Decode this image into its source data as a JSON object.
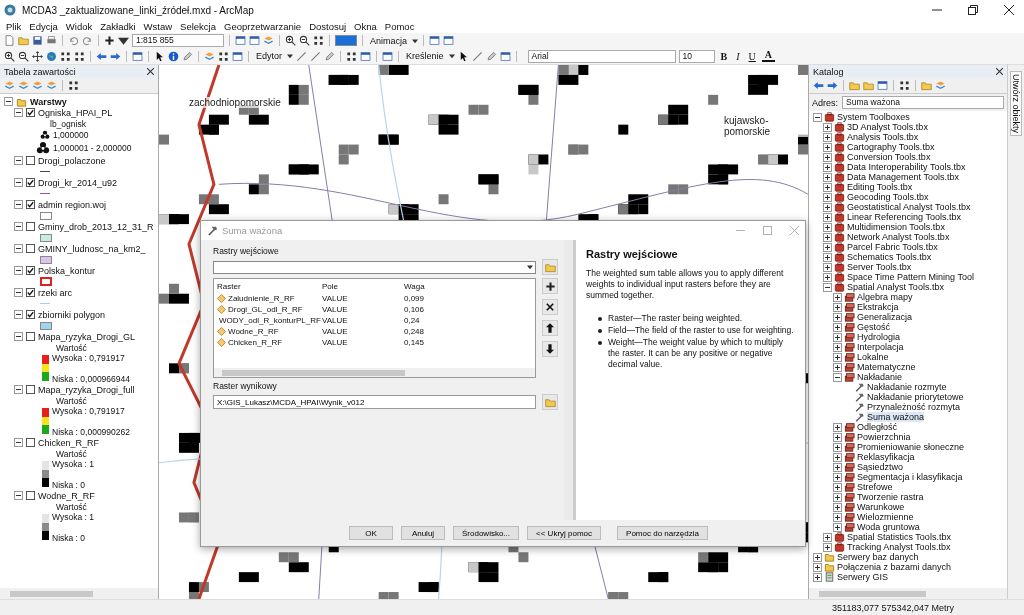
{
  "window": {
    "title": "MCDA3 _zaktualizowane_linki_źródeł.mxd - ArcMap"
  },
  "menu": [
    "Plik",
    "Edycja",
    "Widok",
    "Zakładki",
    "Wstaw",
    "Selekcja",
    "Geoprzetwarzanie",
    "Dostosuj",
    "Okna",
    "Pomoc"
  ],
  "toolbar": {
    "scale": "1:815 855",
    "editor": "Edytor",
    "animation": "Animacja",
    "drawing": "Kreślenie",
    "font": "Arial",
    "font_size": "10",
    "bold": "B",
    "italic": "I",
    "underline": "U",
    "font_color": "A"
  },
  "toc": {
    "title": "Tabela zawartości",
    "root": "Warstwy",
    "layers": [
      {
        "name": "Ogniska_HPAI_PL",
        "checked": true,
        "expanded": true,
        "legend": [
          {
            "kind": "heading",
            "label": "lb_ognisk"
          },
          {
            "kind": "symbol",
            "label": "1,000000"
          },
          {
            "kind": "symbol-large",
            "label": "1,000001 - 2,000000"
          }
        ]
      },
      {
        "name": "Drogi_polaczone",
        "checked": false,
        "expanded": true,
        "legend": [
          {
            "kind": "line",
            "color": "#5a3a6a"
          }
        ]
      },
      {
        "name": "Drogi_kr_2014_u92",
        "checked": true,
        "expanded": true,
        "legend": [
          {
            "kind": "line",
            "color": "#8a5a9a"
          }
        ]
      },
      {
        "name": "admin region.woj",
        "checked": true,
        "expanded": true,
        "legend": [
          {
            "kind": "fill",
            "color": "#ffffff"
          }
        ]
      },
      {
        "name": "Gminy_drob_2013_12_31_R",
        "checked": false,
        "expanded": true,
        "legend": [
          {
            "kind": "fill",
            "color": "#c6eee0"
          }
        ]
      },
      {
        "name": "GMINY_ludnosc_na_km2_",
        "checked": false,
        "expanded": true,
        "legend": [
          {
            "kind": "fill",
            "color": "#dcc3ee"
          }
        ]
      },
      {
        "name": "Polska_kontur",
        "checked": true,
        "expanded": true,
        "legend": [
          {
            "kind": "outline",
            "color": "#e02020"
          }
        ]
      },
      {
        "name": "rzeki arc",
        "checked": true,
        "expanded": true,
        "legend": [
          {
            "kind": "line",
            "color": "#a9cdea"
          }
        ]
      },
      {
        "name": "zbiorniki polygon",
        "checked": true,
        "expanded": true,
        "legend": [
          {
            "kind": "fill",
            "color": "#9fd4f2"
          }
        ]
      },
      {
        "name": "Mapa_ryzyka_Drogi_GL",
        "checked": false,
        "expanded": true,
        "legend": [
          {
            "kind": "ramp",
            "title": "Wartość",
            "high": "Wysoka : 0,791917",
            "low": "Niska : 0,000966944",
            "stops": [
              {
                "color": "#e8201c"
              },
              {
                "color": "#f5e41c"
              },
              {
                "color": "#1ea81e"
              }
            ]
          }
        ]
      },
      {
        "name": "Mapa_ryzyka_Drogi_full",
        "checked": false,
        "expanded": true,
        "legend": [
          {
            "kind": "ramp",
            "title": "Wartość",
            "high": "Wysoka : 0,791917",
            "low": "Niska : 0,000990262",
            "stops": [
              {
                "color": "#e8201c"
              },
              {
                "color": "#f5e41c"
              },
              {
                "color": "#1ea81e"
              }
            ]
          }
        ]
      },
      {
        "name": "Chicken_R_RF",
        "checked": false,
        "expanded": true,
        "legend": [
          {
            "kind": "ramp",
            "title": "Wartość",
            "high": "Wysoka : 1",
            "low": "Niska : 0",
            "stops": [
              {
                "color": "#e4e4e4"
              },
              {
                "color": "#8a8a8a"
              },
              {
                "color": "#000000"
              }
            ]
          }
        ]
      },
      {
        "name": "Wodne_R_RF",
        "checked": false,
        "expanded": true,
        "legend": [
          {
            "kind": "ramp",
            "title": "Wartość",
            "high": "Wysoka : 1",
            "low": "Niska : 0",
            "stops": [
              {
                "color": "#e4e4e4"
              },
              {
                "color": "#8a8a8a"
              },
              {
                "color": "#000000"
              }
            ]
          }
        ]
      }
    ]
  },
  "map": {
    "labels": [
      "zachodniopomorskie",
      "kujawsko-pomorskie"
    ]
  },
  "dialog": {
    "title": "Suma ważona",
    "input_label": "Rastry wejściowe",
    "columns": [
      "Raster",
      "Pole",
      "Waga"
    ],
    "rows": [
      [
        "Zaludnienie_R_RF",
        "VALUE",
        "0,099"
      ],
      [
        "Drogi_GL_odl_R_RF",
        "VALUE",
        "0,106"
      ],
      [
        "WODY_odl_R_konturPL_RF",
        "VALUE",
        "0,24"
      ],
      [
        "Wodne_R_RF",
        "VALUE",
        "0,248"
      ],
      [
        "Chicken_R_RF",
        "VALUE",
        "0,145"
      ]
    ],
    "output_label": "Raster wynikowy",
    "output_value": "X:\\GIS_Lukasz\\MCDA_HPAI\\Wynik_v012",
    "buttons": [
      "OK",
      "Anuluj",
      "Środowisko...",
      "<< Ukryj pomoc",
      "Pomoc do narzędzia"
    ],
    "help": {
      "heading": "Rastry wejściowe",
      "text": "The weighted sum table allows you to apply different weights to individual input rasters before they are summed together.",
      "bullets": [
        "Raster—The raster being weighted.",
        "Field—The field of the raster to use for weighting.",
        "Weight—The weight value by which to multiply the raster. It can be any positive or negative decimal value."
      ]
    }
  },
  "catalog": {
    "title": "Katalog",
    "address_label": "Adres:",
    "address": "Suma ważona",
    "tree": [
      {
        "label": "System Toolboxes",
        "kind": "toolboxes",
        "expanded": true,
        "children": [
          {
            "label": "3D Analyst Tools.tbx",
            "kind": "toolbox",
            "expanded": false
          },
          {
            "label": "Analysis Tools.tbx",
            "kind": "toolbox",
            "expanded": false
          },
          {
            "label": "Cartography Tools.tbx",
            "kind": "toolbox",
            "expanded": false
          },
          {
            "label": "Conversion Tools.tbx",
            "kind": "toolbox",
            "expanded": false
          },
          {
            "label": "Data Interoperability Tools.tbx",
            "kind": "toolbox",
            "expanded": false
          },
          {
            "label": "Data Management Tools.tbx",
            "kind": "toolbox",
            "expanded": false
          },
          {
            "label": "Editing Tools.tbx",
            "kind": "toolbox",
            "expanded": false
          },
          {
            "label": "Geocoding Tools.tbx",
            "kind": "toolbox",
            "expanded": false
          },
          {
            "label": "Geostatistical Analyst Tools.tbx",
            "kind": "toolbox",
            "expanded": false
          },
          {
            "label": "Linear Referencing Tools.tbx",
            "kind": "toolbox",
            "expanded": false
          },
          {
            "label": "Multidimension Tools.tbx",
            "kind": "toolbox",
            "expanded": false
          },
          {
            "label": "Network Analyst Tools.tbx",
            "kind": "toolbox",
            "expanded": false
          },
          {
            "label": "Parcel Fabric Tools.tbx",
            "kind": "toolbox",
            "expanded": false
          },
          {
            "label": "Schematics Tools.tbx",
            "kind": "toolbox",
            "expanded": false
          },
          {
            "label": "Server Tools.tbx",
            "kind": "toolbox",
            "expanded": false
          },
          {
            "label": "Space Time Pattern Mining Tool",
            "kind": "toolbox",
            "expanded": false
          },
          {
            "label": "Spatial Analyst Tools.tbx",
            "kind": "toolbox",
            "expanded": true,
            "children": [
              {
                "label": "Algebra mapy",
                "kind": "toolset",
                "expanded": false
              },
              {
                "label": "Ekstrakcja",
                "kind": "toolset",
                "expanded": false
              },
              {
                "label": "Generalizacja",
                "kind": "toolset",
                "expanded": false
              },
              {
                "label": "Gęstość",
                "kind": "toolset",
                "expanded": false
              },
              {
                "label": "Hydrologia",
                "kind": "toolset",
                "expanded": false
              },
              {
                "label": "Interpolacja",
                "kind": "toolset",
                "expanded": false
              },
              {
                "label": "Lokalne",
                "kind": "toolset",
                "expanded": false
              },
              {
                "label": "Matematyczne",
                "kind": "toolset",
                "expanded": false
              },
              {
                "label": "Nakładanie",
                "kind": "toolset",
                "expanded": true,
                "children": [
                  {
                    "label": "Nakładanie rozmyte",
                    "kind": "tool",
                    "selected": false
                  },
                  {
                    "label": "Nakładanie priorytetowe",
                    "kind": "tool",
                    "selected": false
                  },
                  {
                    "label": "Przynależność rozmyta",
                    "kind": "tool",
                    "selected": false
                  },
                  {
                    "label": "Suma ważona",
                    "kind": "tool",
                    "selected": true
                  }
                ]
              },
              {
                "label": "Odległość",
                "kind": "toolset",
                "expanded": false
              },
              {
                "label": "Powierzchnia",
                "kind": "toolset",
                "expanded": false
              },
              {
                "label": "Promieniowanie słoneczne",
                "kind": "toolset",
                "expanded": false
              },
              {
                "label": "Reklasyfikacja",
                "kind": "toolset",
                "expanded": false
              },
              {
                "label": "Sąsiedztwo",
                "kind": "toolset",
                "expanded": false
              },
              {
                "label": "Segmentacja i klasyfikacja",
                "kind": "toolset",
                "expanded": false
              },
              {
                "label": "Strefowe",
                "kind": "toolset",
                "expanded": false
              },
              {
                "label": "Tworzenie rastra",
                "kind": "toolset",
                "expanded": false
              },
              {
                "label": "Warunkowe",
                "kind": "toolset",
                "expanded": false
              },
              {
                "label": "Wielozmienne",
                "kind": "toolset",
                "expanded": false
              },
              {
                "label": "Woda gruntowa",
                "kind": "toolset",
                "expanded": false
              }
            ]
          },
          {
            "label": "Spatial Statistics Tools.tbx",
            "kind": "toolbox",
            "expanded": false
          },
          {
            "label": "Tracking Analyst Tools.tbx",
            "kind": "toolbox",
            "expanded": false
          }
        ]
      },
      {
        "label": "Serwery baz danych",
        "kind": "folder",
        "expanded": false
      },
      {
        "label": "Połączenia z bazami danych",
        "kind": "folder",
        "expanded": false
      },
      {
        "label": "Serwery GIS",
        "kind": "server",
        "expanded": false
      }
    ]
  },
  "side_tab": "Utwórz obiekty",
  "status": "351183,077  575342,047 Metry"
}
